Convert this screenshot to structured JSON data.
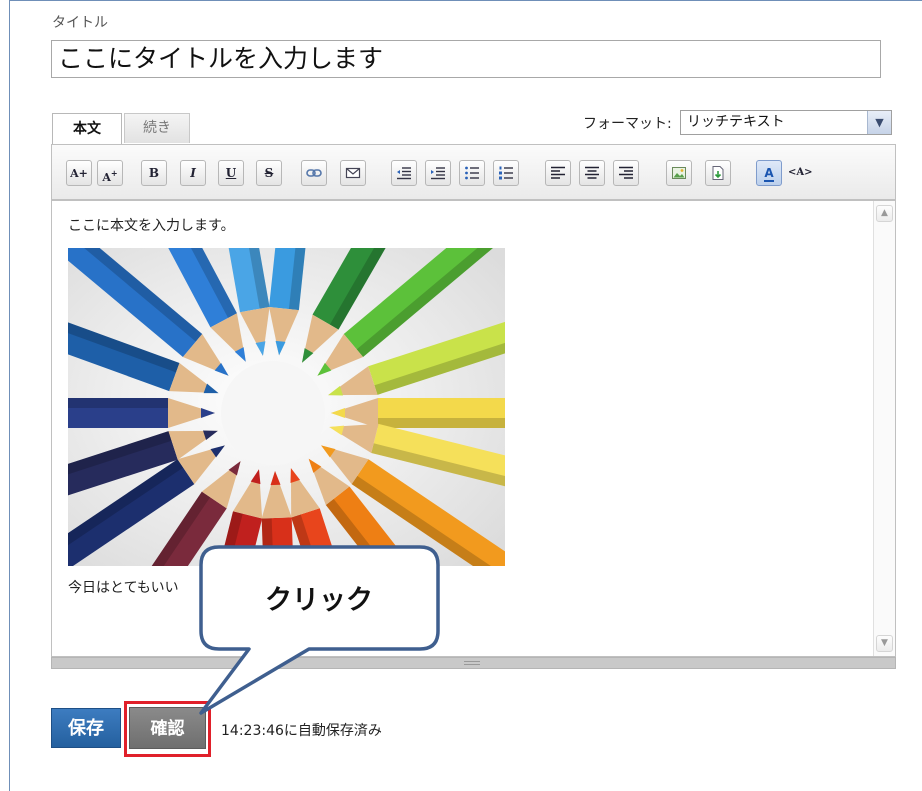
{
  "title_section": {
    "label": "タイトル",
    "value": "ここにタイトルを入力します"
  },
  "tabs": [
    {
      "label": "本文",
      "active": true
    },
    {
      "label": "続き",
      "active": false
    }
  ],
  "format": {
    "label": "フォーマット:",
    "selected": "リッチテキスト"
  },
  "toolbar": {
    "buttons": [
      {
        "icon": "font-size-increase-icon",
        "glyph": "A+"
      },
      {
        "icon": "font-size-decrease-icon",
        "glyph": "A"
      },
      {
        "icon": "bold-icon",
        "glyph": "B"
      },
      {
        "icon": "italic-icon",
        "glyph": "I"
      },
      {
        "icon": "underline-icon",
        "glyph": "U"
      },
      {
        "icon": "strikethrough-icon",
        "glyph": "S"
      },
      {
        "icon": "link-icon"
      },
      {
        "icon": "email-icon"
      },
      {
        "icon": "outdent-icon"
      },
      {
        "icon": "indent-icon"
      },
      {
        "icon": "bullet-list-icon"
      },
      {
        "icon": "numbered-list-icon"
      },
      {
        "icon": "align-left-icon"
      },
      {
        "icon": "align-center-icon"
      },
      {
        "icon": "align-right-icon"
      },
      {
        "icon": "insert-image-icon"
      },
      {
        "icon": "insert-file-icon"
      },
      {
        "icon": "text-color-icon",
        "glyph": "A"
      },
      {
        "icon": "html-source-icon",
        "glyph": "<A>"
      }
    ]
  },
  "editor": {
    "line1": "ここに本文を入力します。",
    "line2": "今日はとてもいい"
  },
  "actions": {
    "save_label": "保存",
    "confirm_label": "確認",
    "autosave_text": "14:23:46に自動保存済み"
  },
  "callout": {
    "label": "クリック"
  },
  "colors": {
    "save_button": "#2d6cad",
    "confirm_button": "#7d7d7d",
    "highlight": "#e0202a",
    "callout_border": "#3f5f8f"
  }
}
